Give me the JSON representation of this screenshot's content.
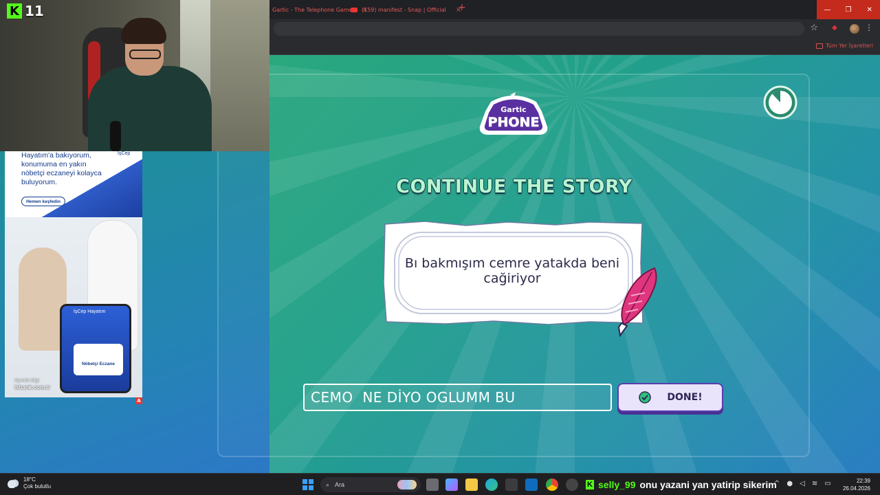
{
  "browser": {
    "tabs": [
      {
        "label": "Gartic - The Telephone Game",
        "close": "×"
      },
      {
        "label": "(159) manifest - Snap | Official",
        "close": "×"
      }
    ],
    "new_tab": "+",
    "bookmarks_all": "Tüm Yer İşaretleri",
    "window_controls": [
      "—",
      "❐",
      "✕"
    ],
    "star": "☆",
    "menu": "⋮"
  },
  "stream": {
    "kick_logo": "K",
    "viewer_count": "11"
  },
  "ad": {
    "title": "Hayatım'a bakıyorum, konumuma en yakın nöbetçi eczaneyi kolayca buluyorum.",
    "brand": "İşCep",
    "cta": "Hemen keşfedin",
    "phone_title": "İşCep Hayatım",
    "card_label": "Nöbetçi Eczane",
    "footer_small": "Ayrıntılı bilgi:",
    "footer_url": "isbank.com.tr",
    "marker": "A"
  },
  "game": {
    "logo_top": "Gartic",
    "logo_bottom": "PHONE",
    "heading": "CONTINUE THE STORY",
    "prompt_text": "Bı bakmışım cemre yatakda beni cağiriyor",
    "answer_value": "CEMO  NE DİYO OGLUMM BU",
    "done_label": "DONE!",
    "timer_fraction_remaining": 0.88,
    "colors": {
      "bg_green": "#2aa87e",
      "bg_blue": "#2a7ec2",
      "heading": "#b9f5d0",
      "button_border": "#5a3db0",
      "feather": "#e0357f"
    }
  },
  "taskbar": {
    "weather_temp": "18°C",
    "weather_desc": "Çok bulutlu",
    "search_placeholder": "Ara",
    "chat_user": "selly_99",
    "chat_message": "onu yazani yan yatirip sikerim",
    "time": "22:39",
    "date": "26.04.2026",
    "tray_icons": [
      "chevron-up-icon",
      "mic-icon",
      "speaker-icon",
      "wifi-icon",
      "battery-icon"
    ]
  }
}
